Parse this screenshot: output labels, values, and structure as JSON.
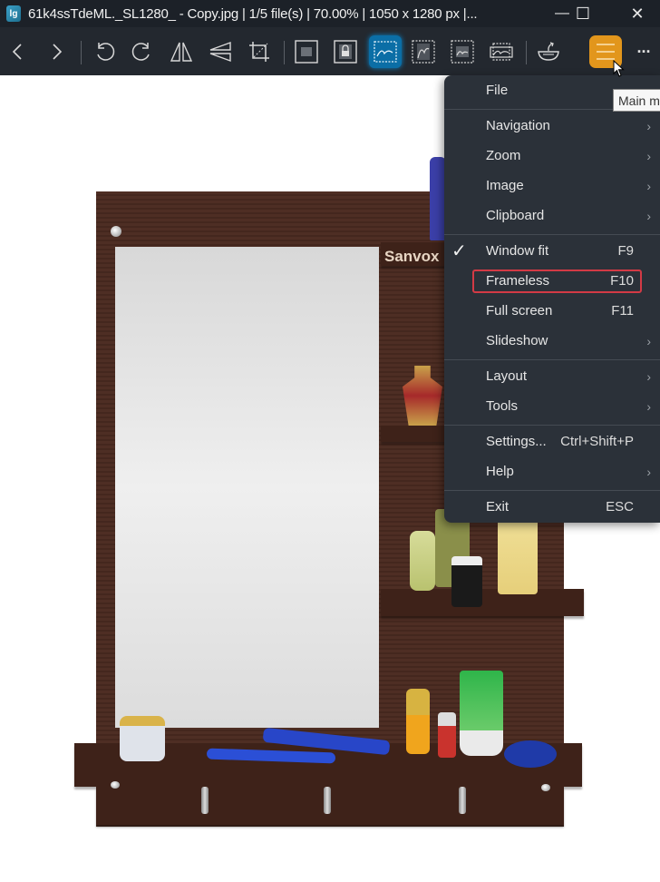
{
  "window": {
    "app_icon_label": "lg",
    "title": "61k4ssTdeML._SL1280_ - Copy.jpg  |  1/5 file(s)  |  70.00%  |  1050 x 1280 px  |...",
    "minimize_glyph": "—",
    "maximize_glyph": "☐",
    "close_glyph": "✕"
  },
  "toolbar": {
    "more_glyph": "···",
    "buttons": [
      {
        "name": "previous-image",
        "icon": "chevron-left"
      },
      {
        "name": "next-image",
        "icon": "chevron-right"
      },
      {
        "name": "rotate-left",
        "icon": "rotate-ccw"
      },
      {
        "name": "rotate-right",
        "icon": "rotate-cw"
      },
      {
        "name": "flip-horizontal",
        "icon": "flip-h"
      },
      {
        "name": "flip-vertical",
        "icon": "flip-v"
      },
      {
        "name": "crop",
        "icon": "crop"
      },
      {
        "name": "auto-zoom",
        "icon": "image"
      },
      {
        "name": "lock-zoom",
        "icon": "image-lock"
      },
      {
        "name": "scale-to-width",
        "icon": "image-width",
        "active": true
      },
      {
        "name": "scale-to-height",
        "icon": "image-height"
      },
      {
        "name": "scale-to-fit",
        "icon": "image-fit"
      },
      {
        "name": "scale-to-fill",
        "icon": "image-fill"
      },
      {
        "name": "checkerboard",
        "icon": "bowl"
      },
      {
        "name": "main-menu",
        "icon": "hamburger",
        "active": true
      }
    ],
    "accent_active": "#0b6ea6",
    "accent_menu": "#e2961c"
  },
  "tooltip": "Main menu",
  "image": {
    "brand_text": "Sanvox"
  },
  "menu": {
    "items": [
      {
        "label": "File",
        "shortcut": "",
        "submenu": true
      },
      {
        "label": "Navigation",
        "shortcut": "",
        "submenu": true
      },
      {
        "label": "Zoom",
        "shortcut": "",
        "submenu": true
      },
      {
        "label": "Image",
        "shortcut": "",
        "submenu": true
      },
      {
        "label": "Clipboard",
        "shortcut": "",
        "submenu": true
      },
      {
        "label": "Window fit",
        "shortcut": "F9",
        "checked": true
      },
      {
        "label": "Frameless",
        "shortcut": "F10",
        "highlighted": true
      },
      {
        "label": "Full screen",
        "shortcut": "F11"
      },
      {
        "label": "Slideshow",
        "shortcut": "",
        "submenu": true
      },
      {
        "label": "Layout",
        "shortcut": "",
        "submenu": true
      },
      {
        "label": "Tools",
        "shortcut": "",
        "submenu": true
      },
      {
        "label": "Settings...",
        "shortcut": "Ctrl+Shift+P"
      },
      {
        "label": "Help",
        "shortcut": "",
        "submenu": true
      },
      {
        "label": "Exit",
        "shortcut": "ESC"
      }
    ],
    "check_glyph": "✓",
    "arrow_glyph": "›",
    "highlight_color": "#d33a45"
  }
}
